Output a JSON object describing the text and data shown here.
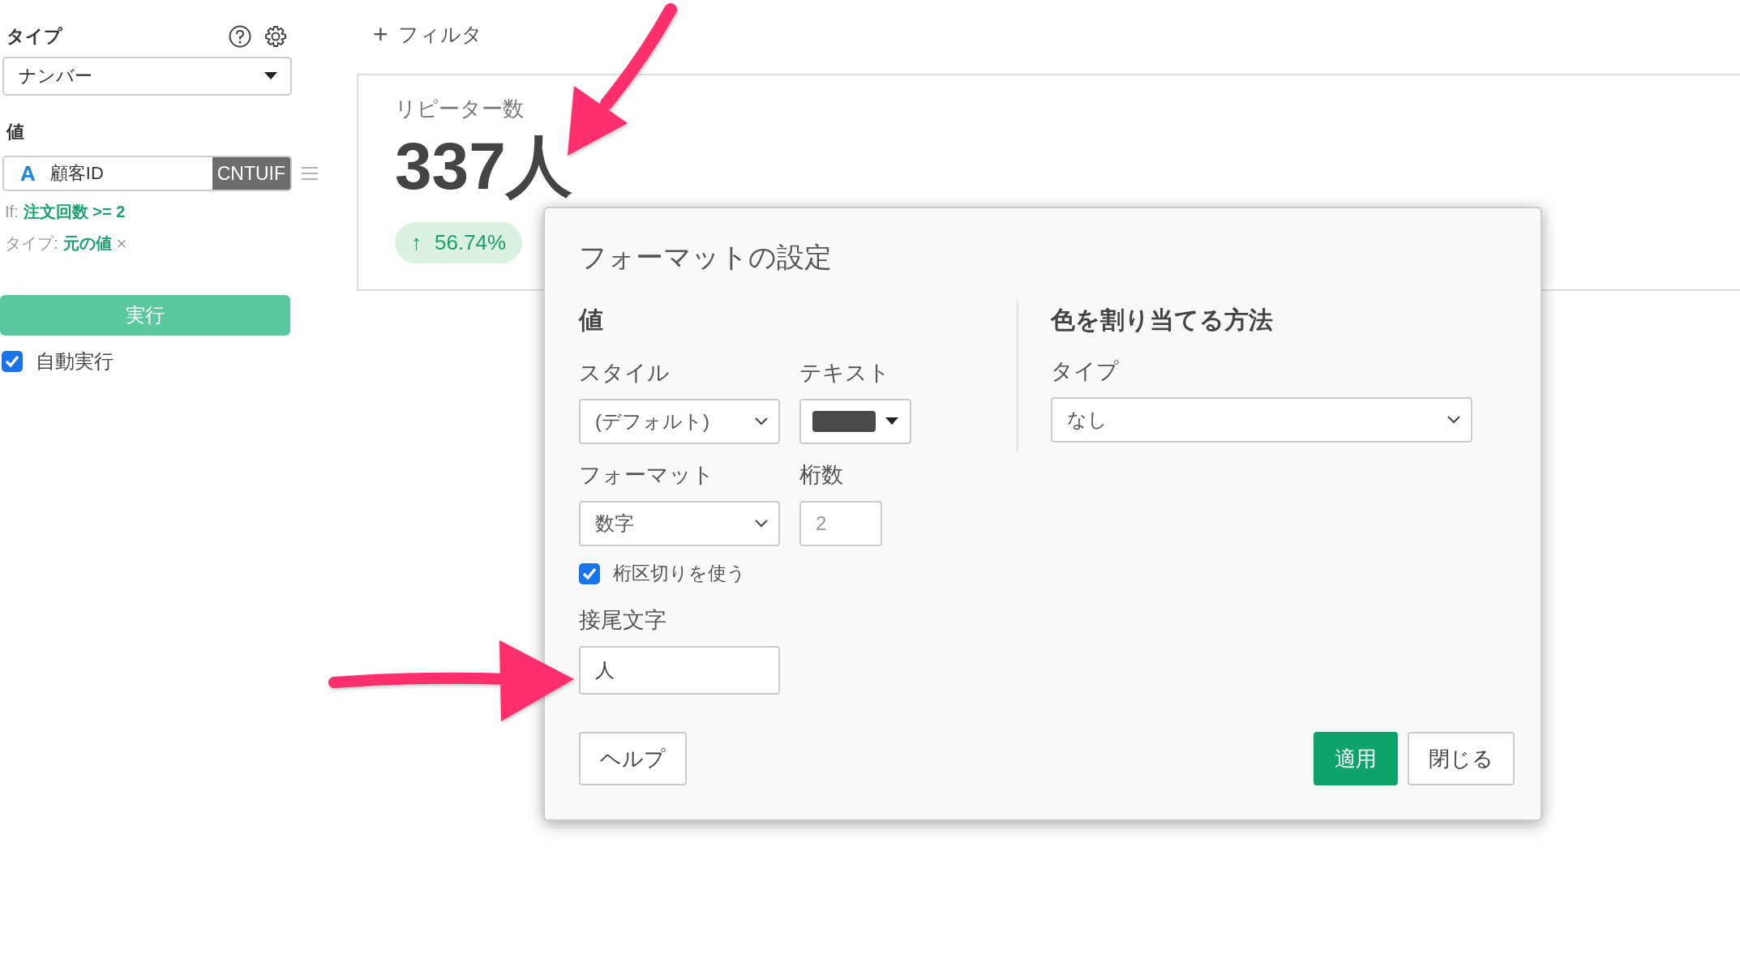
{
  "sidebar": {
    "type_label": "タイプ",
    "type_select": "ナンバー",
    "value_label": "値",
    "value_field": {
      "type_icon": "A",
      "text": "顧客ID",
      "function": "CNTUIF"
    },
    "condition": {
      "label": "If:",
      "value": "注文回数 >= 2"
    },
    "value_type": {
      "label": "タイプ:",
      "value": "元の値",
      "remove": "×"
    },
    "run_button": "実行",
    "auto_run": {
      "label": "自動実行",
      "checked": true
    }
  },
  "filter_button": {
    "icon": "+",
    "label": "フィルタ"
  },
  "card": {
    "title": "リピーター数",
    "value": "337人",
    "change": {
      "arrow": "↑",
      "value": "56.74%"
    }
  },
  "dialog": {
    "title": "フォーマットの設定",
    "value_section": {
      "heading": "値",
      "style_label": "スタイル",
      "style_select": "(デフォルト)",
      "text_label": "テキスト",
      "text_picker": {
        "color": "#4a4a4a"
      },
      "format_label": "フォーマット",
      "format_select": "数字",
      "digits_label": "桁数",
      "digits_placeholder": "2",
      "separator": {
        "label": "桁区切りを使う",
        "checked": true
      },
      "suffix_label": "接尾文字",
      "suffix_value": "人"
    },
    "color_section": {
      "heading": "色を割り当てる方法",
      "type_label": "タイプ",
      "type_select": "なし"
    },
    "buttons": [
      {
        "label": "ヘルプ",
        "kind": "secondary"
      },
      {
        "label": "適用",
        "kind": "primary"
      },
      {
        "label": "閉じる",
        "kind": "secondary"
      }
    ]
  },
  "annotations": [
    {
      "kind": "arrow"
    },
    {
      "kind": "arrow"
    }
  ]
}
